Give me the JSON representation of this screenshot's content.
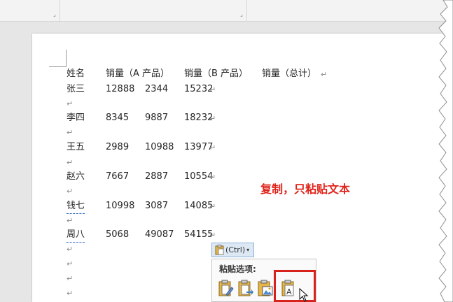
{
  "table": {
    "headers": [
      "姓名",
      "销量（A 产品）",
      "销量（B 产品）",
      "销量（总计）"
    ],
    "rows": [
      [
        "张三",
        "12888",
        "2344",
        "15232"
      ],
      [
        "李四",
        "8345",
        "9887",
        "18232"
      ],
      [
        "王五",
        "2989",
        "10988",
        "13977"
      ],
      [
        "赵六",
        "7667",
        "2887",
        "10554"
      ],
      [
        "钱七",
        "10998",
        "3087",
        "14085"
      ],
      [
        "周八",
        "5068",
        "49087",
        "54155"
      ]
    ]
  },
  "paragraph_mark": "↵",
  "annotation": "复制，只粘贴文本",
  "paste_control": {
    "button_label": "(Ctrl)",
    "menu_title": "粘贴选项:",
    "icons": [
      "keep-source-formatting-icon",
      "merge-formatting-icon",
      "paste-picture-icon",
      "keep-text-only-icon"
    ]
  },
  "colors": {
    "annotation": "#e0241b",
    "highlight_box": "#d6231b",
    "paste_button_bg": "#dde8f5"
  }
}
